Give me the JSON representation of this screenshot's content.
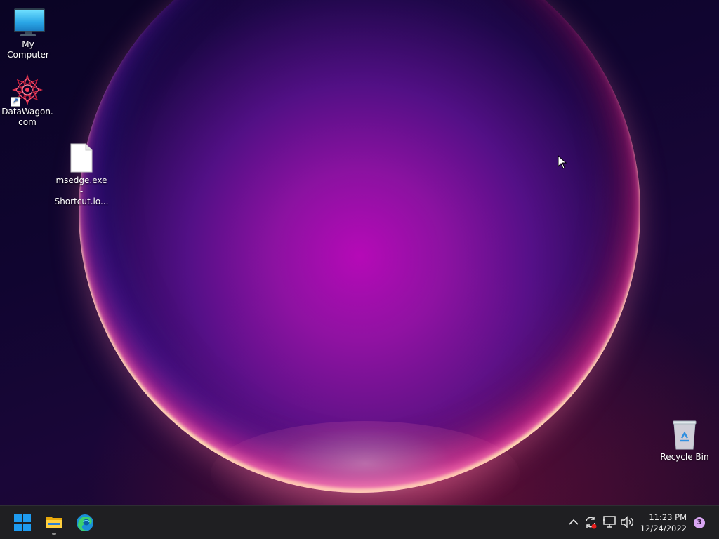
{
  "desktop": {
    "icons": [
      {
        "label": "My Computer",
        "icon": "monitor-icon"
      },
      {
        "label": "DataWagon.com",
        "icon": "starburst-shortcut-icon"
      },
      {
        "label": "msedge.exe - Shortcut.lo...",
        "icon": "blank-file-icon"
      },
      {
        "label": "Recycle Bin",
        "icon": "recycle-bin-icon"
      }
    ]
  },
  "taskbar": {
    "pinned": [
      {
        "name": "Start",
        "icon": "windows-logo-icon"
      },
      {
        "name": "File Explorer",
        "icon": "folder-icon",
        "running": true
      },
      {
        "name": "Microsoft Edge",
        "icon": "edge-icon"
      }
    ],
    "tray": {
      "icons": [
        "chevron-up-icon",
        "sync-icon",
        "network-icon",
        "volume-icon"
      ],
      "time": "11:23 PM",
      "date": "12/24/2022",
      "notification_count": "3"
    }
  },
  "colors": {
    "taskbar_bg": "#1f1f22",
    "notification_badge": "#d9a6f2",
    "windows_blue": "#1e9bf0"
  }
}
